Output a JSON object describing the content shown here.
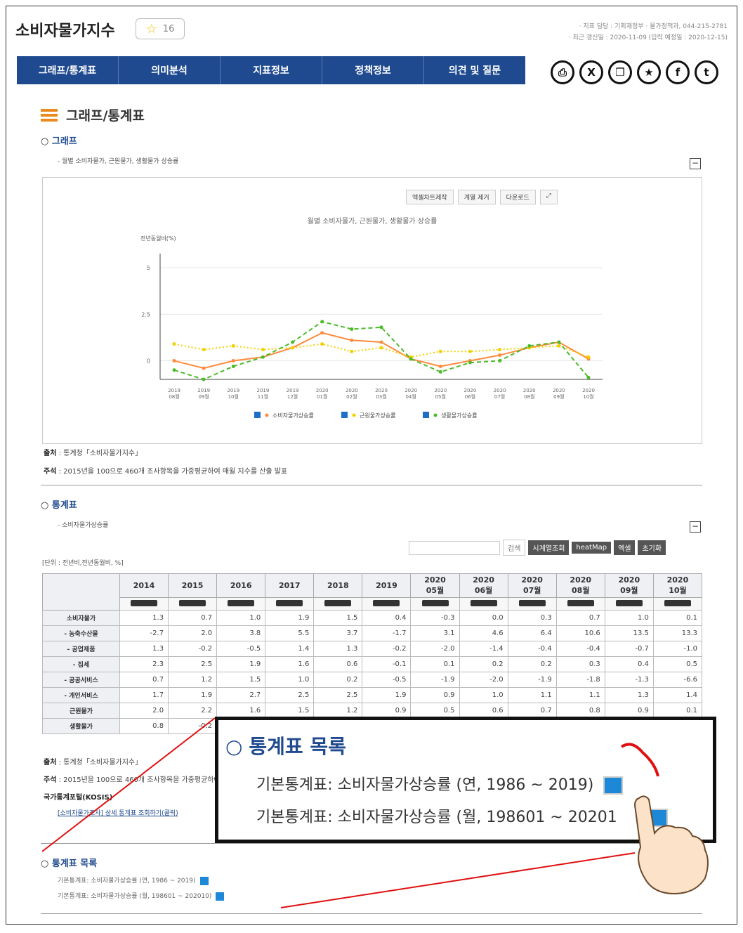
{
  "header": {
    "title": "소비자물가지수",
    "star_count": "16",
    "meta_line1": "· 지표 담당 : 기획재정부 · 물가정책과, 044-215-2781",
    "meta_line2": "· 최근 갱신일 : 2020-11-09 (입력 예정일 : 2020-12-15)"
  },
  "nav": [
    "그래프/통계표",
    "의미분석",
    "지표정보",
    "정책정보",
    "의견 및 질문"
  ],
  "share_icons": [
    "print-icon",
    "excel-icon",
    "copy-icon",
    "star-icon",
    "facebook-icon",
    "twitter-icon"
  ],
  "section": {
    "title": "그래프/통계표",
    "graph_label": "그래프",
    "graph_note": "- 월별 소비자물가, 근원물가, 생활물가 상승률",
    "table_label": "통계표",
    "table_note": "- 소비자물가상승률",
    "unit_note": "[단위 : 전년비,전년동월비, %]",
    "list_label": "통계표 목록"
  },
  "chart_tools": [
    "엑셀차트제작",
    "계열 제거",
    "다운로드"
  ],
  "chart_data": {
    "type": "line",
    "title": "월별 소비자물가, 근원물가, 생활물가 상승률",
    "ylabel": "전년동월비(%)",
    "ylim": [
      -1,
      5
    ],
    "yticks": [
      "5",
      "2.5",
      "0"
    ],
    "categories": [
      "2019\n08월",
      "2019\n09월",
      "2019\n10월",
      "2019\n11월",
      "2019\n12월",
      "2020\n01월",
      "2020\n02월",
      "2020\n03월",
      "2020\n04월",
      "2020\n05월",
      "2020\n06월",
      "2020\n07월",
      "2020\n08월",
      "2020\n09월",
      "2020\n10월"
    ],
    "series": [
      {
        "name": "소비자물가상승률",
        "color": "#ff8a3c",
        "dash": "",
        "values": [
          0.0,
          -0.4,
          0.0,
          0.2,
          0.7,
          1.5,
          1.1,
          1.0,
          0.1,
          -0.3,
          0.0,
          0.3,
          0.7,
          1.0,
          0.1
        ]
      },
      {
        "name": "근원물가상승률",
        "color": "#f2d000",
        "dash": "2,3",
        "values": [
          0.9,
          0.6,
          0.8,
          0.6,
          0.7,
          0.9,
          0.5,
          0.7,
          0.2,
          0.5,
          0.5,
          0.6,
          0.7,
          0.8,
          0.2
        ]
      },
      {
        "name": "생활물가상승률",
        "color": "#4cbb2a",
        "dash": "6,4",
        "values": [
          -0.5,
          -1.0,
          -0.3,
          0.2,
          1.0,
          2.1,
          1.7,
          1.8,
          0.1,
          -0.6,
          -0.1,
          0.0,
          0.8,
          1.0,
          -0.9
        ]
      }
    ]
  },
  "sources": {
    "src_label": "출처",
    "src_text": " : 통계청「소비자물가지수」",
    "note_label": "주석",
    "note_text": " : 2015년을 100으로 460개 조사항목을 가중평균하여 매월 지수를 산출 발표",
    "kosis_label": "국가통계포털(KOSIS)",
    "kosis_text": "[소비자물가조사] 상세 통계표 조회하기(클릭)"
  },
  "table_buttons": {
    "search": "검색",
    "b1": "시계열조회",
    "b2": "heatMap",
    "b3": "엑셀",
    "b4": "초기화"
  },
  "table": {
    "headers": [
      "2014",
      "2015",
      "2016",
      "2017",
      "2018",
      "2019",
      "2020\n05월",
      "2020\n06월",
      "2020\n07월",
      "2020\n08월",
      "2020\n09월",
      "2020\n10월"
    ],
    "rows": [
      {
        "label": "소비자물가",
        "values": [
          "1.3",
          "0.7",
          "1.0",
          "1.9",
          "1.5",
          "0.4",
          "-0.3",
          "0.0",
          "0.3",
          "0.7",
          "1.0",
          "0.1"
        ]
      },
      {
        "label": "- 농축수산물",
        "values": [
          "-2.7",
          "2.0",
          "3.8",
          "5.5",
          "3.7",
          "-1.7",
          "3.1",
          "4.6",
          "6.4",
          "10.6",
          "13.5",
          "13.3"
        ]
      },
      {
        "label": "- 공업제품",
        "values": [
          "1.3",
          "-0.2",
          "-0.5",
          "1.4",
          "1.3",
          "-0.2",
          "-2.0",
          "-1.4",
          "-0.4",
          "-0.4",
          "-0.7",
          "-1.0"
        ]
      },
      {
        "label": "- 집세",
        "values": [
          "2.3",
          "2.5",
          "1.9",
          "1.6",
          "0.6",
          "-0.1",
          "0.1",
          "0.2",
          "0.2",
          "0.3",
          "0.4",
          "0.5"
        ]
      },
      {
        "label": "- 공공서비스",
        "values": [
          "0.7",
          "1.2",
          "1.5",
          "1.0",
          "0.2",
          "-0.5",
          "-1.9",
          "-2.0",
          "-1.9",
          "-1.8",
          "-1.3",
          "-6.6"
        ]
      },
      {
        "label": "- 개인서비스",
        "values": [
          "1.7",
          "1.9",
          "2.7",
          "2.5",
          "2.5",
          "1.9",
          "0.9",
          "1.0",
          "1.1",
          "1.1",
          "1.3",
          "1.4"
        ]
      },
      {
        "label": "근원물가",
        "values": [
          "2.0",
          "2.2",
          "1.6",
          "1.5",
          "1.2",
          "0.9",
          "0.5",
          "0.6",
          "0.7",
          "0.8",
          "0.9",
          "0.1"
        ]
      },
      {
        "label": "생활물가",
        "values": [
          "0.8",
          "-0.2",
          "",
          "",
          "",
          "",
          "",
          "",
          "",
          "",
          "",
          ""
        ]
      }
    ]
  },
  "list": [
    "기본통계표: 소비자물가상승률 (연, 1986 ~ 2019)",
    "기본통계표: 소비자물가상승률 (월, 198601 ~ 202010)"
  ],
  "popup": {
    "title": "통계표 목록",
    "item1": "기본통계표: 소비자물가상승률 (연, 1986 ~ 2019)",
    "item2": "기본통계표: 소비자물가상승률 (월, 198601 ~ 20201"
  }
}
